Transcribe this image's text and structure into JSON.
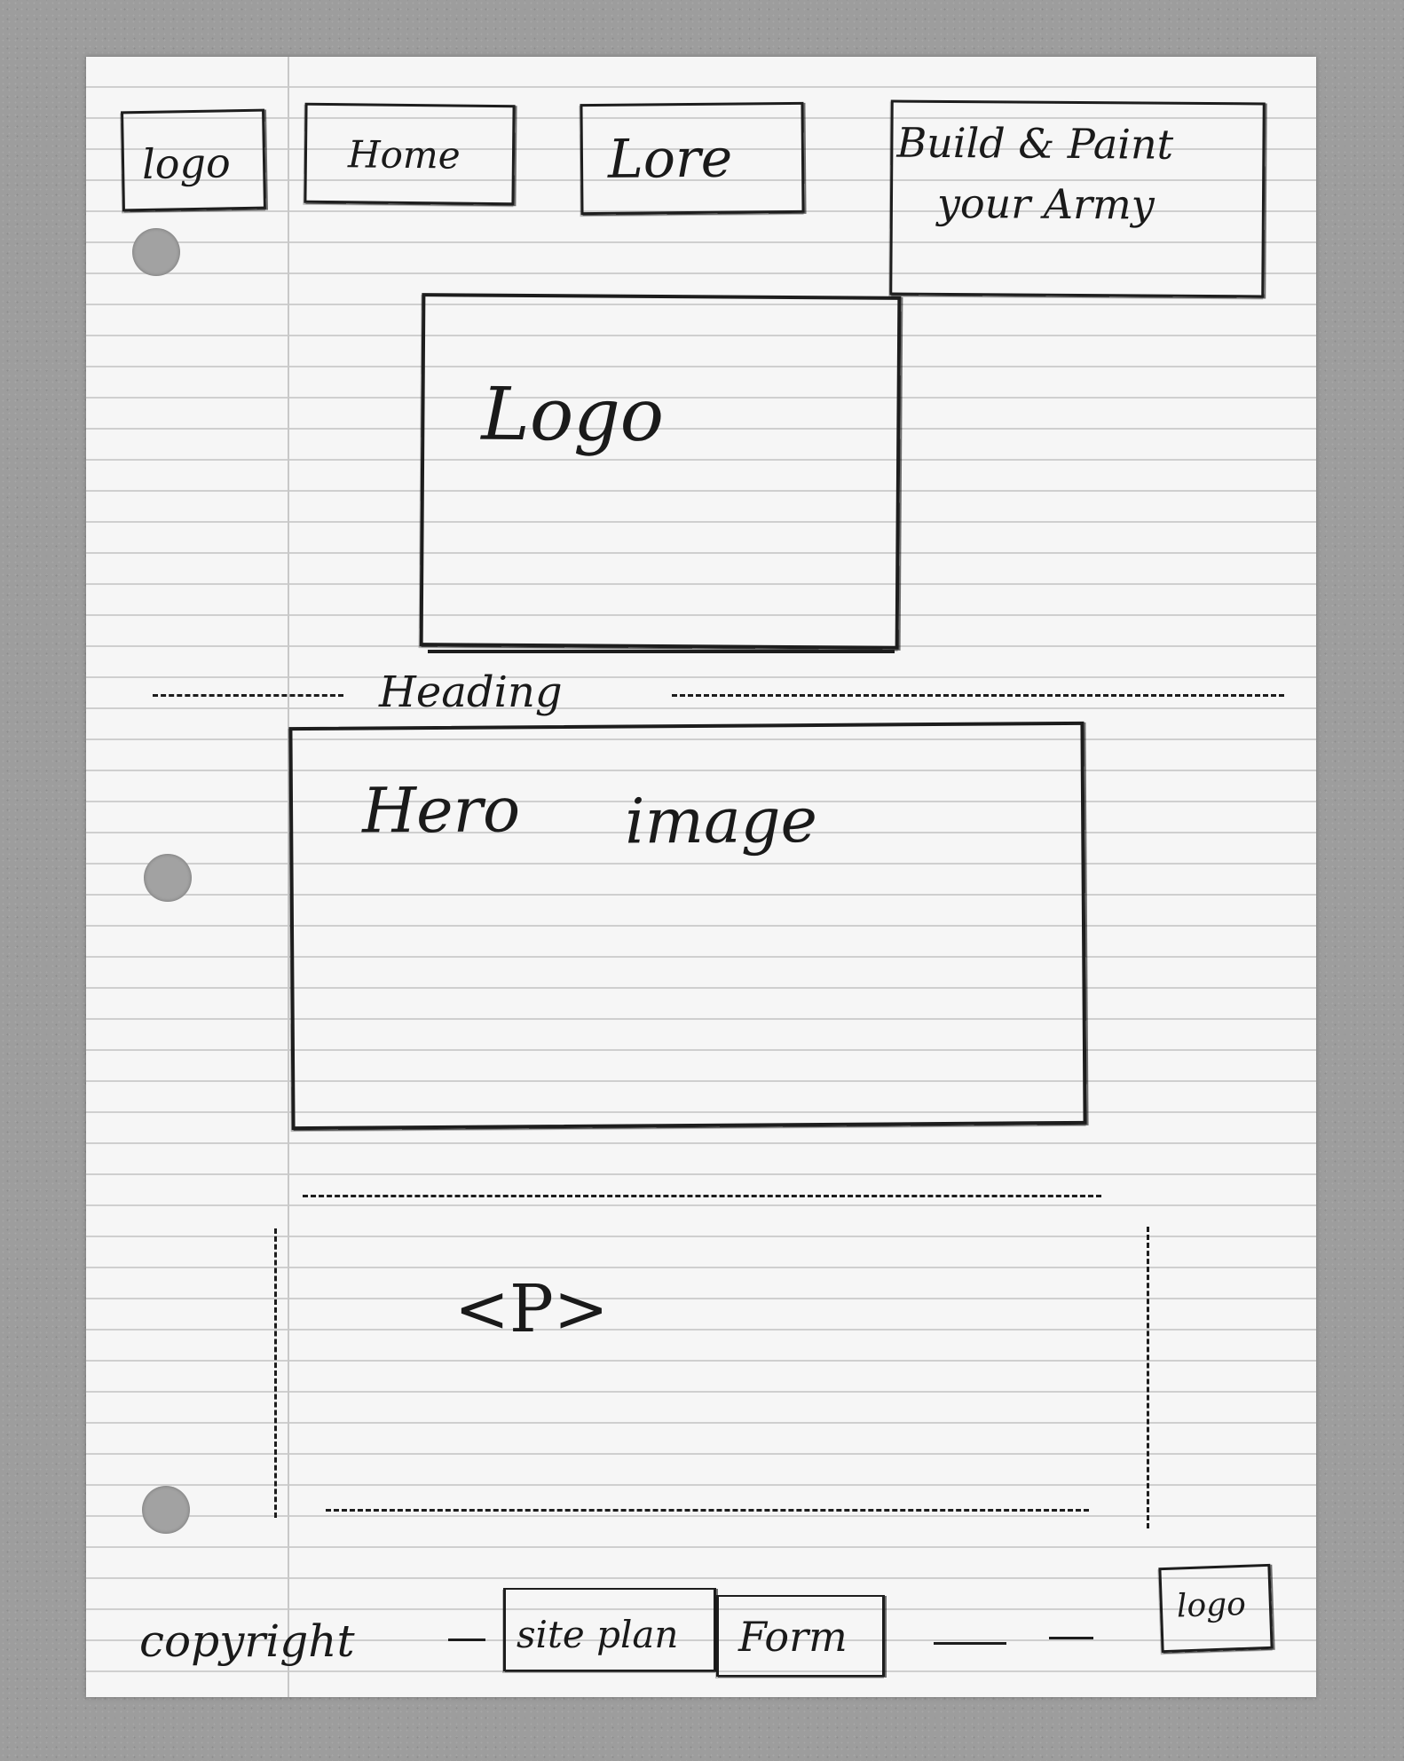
{
  "header": {
    "logo_label": "logo",
    "nav": [
      {
        "label": "Home"
      },
      {
        "label": "Lore"
      },
      {
        "label_line1": "Build & Paint",
        "label_line2": "your Army"
      }
    ]
  },
  "main": {
    "logo_box_label": "Logo",
    "heading_label": "Heading",
    "hero_label_1": "Hero",
    "hero_label_2": "image",
    "paragraph_label": "<P>"
  },
  "footer": {
    "copyright_label": "copyright",
    "links": [
      {
        "label": "site plan"
      },
      {
        "label": "Form"
      }
    ],
    "logo_label": "logo"
  }
}
